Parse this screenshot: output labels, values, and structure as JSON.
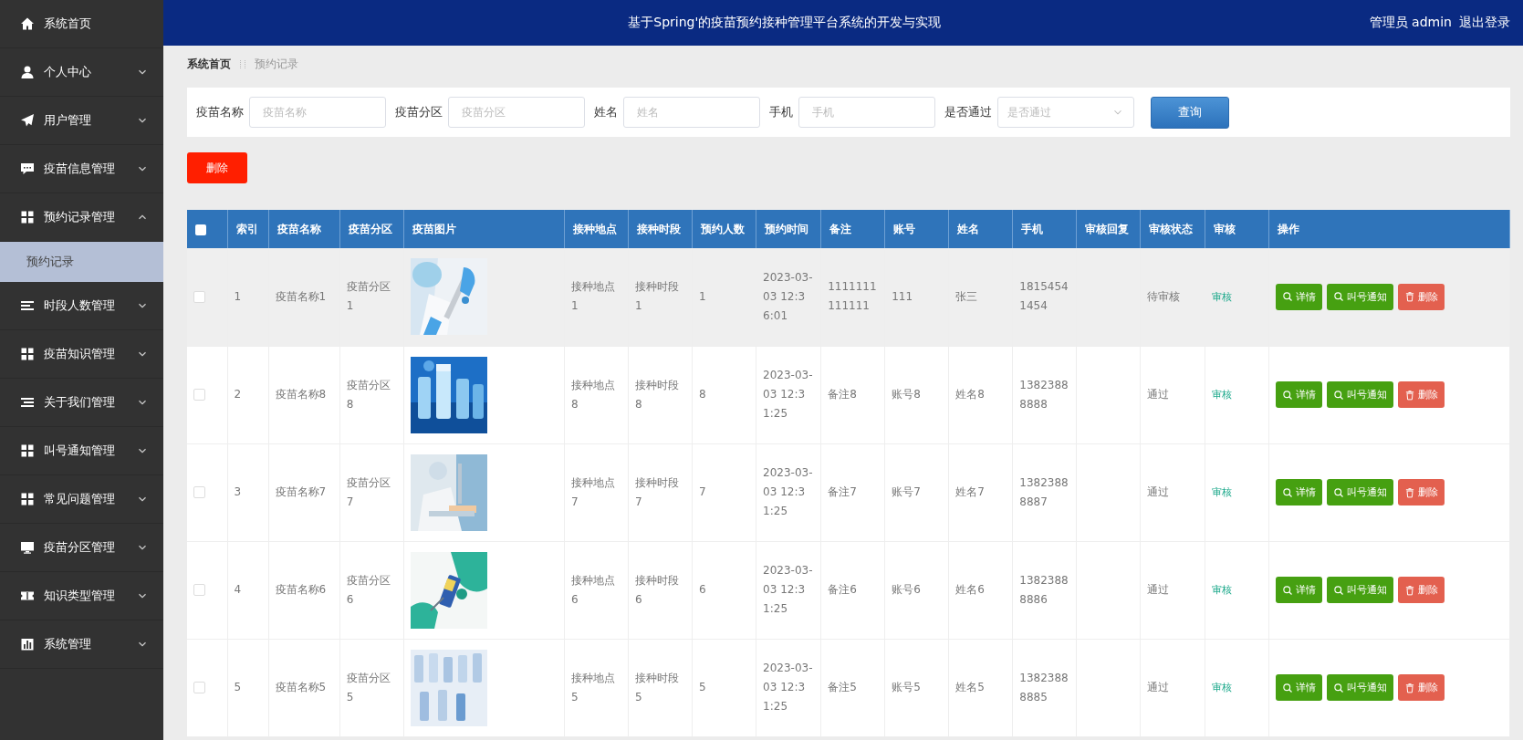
{
  "sidebar": {
    "items": [
      {
        "label": "系统首页"
      },
      {
        "label": "个人中心",
        "expanded": false
      },
      {
        "label": "用户管理",
        "expanded": false
      },
      {
        "label": "疫苗信息管理",
        "expanded": false
      },
      {
        "label": "预约记录管理",
        "expanded": true,
        "children": [
          {
            "label": "预约记录",
            "selected": true
          }
        ]
      },
      {
        "label": "时段人数管理",
        "expanded": false
      },
      {
        "label": "疫苗知识管理",
        "expanded": false
      },
      {
        "label": "关于我们管理",
        "expanded": false
      },
      {
        "label": "叫号通知管理",
        "expanded": false
      },
      {
        "label": "常见问题管理",
        "expanded": false
      },
      {
        "label": "疫苗分区管理",
        "expanded": false
      },
      {
        "label": "知识类型管理",
        "expanded": false
      },
      {
        "label": "系统管理",
        "expanded": false
      }
    ]
  },
  "header": {
    "title": "基于Spring'的疫苗预约接种管理平台系统的开发与实现",
    "user": "管理员 admin",
    "logout": "退出登录"
  },
  "breadcrumb": [
    "系统首页",
    "预约记录"
  ],
  "search": {
    "fields": [
      {
        "label": "疫苗名称",
        "placeholder": "疫苗名称",
        "kind": "text"
      },
      {
        "label": "疫苗分区",
        "placeholder": "疫苗分区",
        "kind": "text"
      },
      {
        "label": "姓名",
        "placeholder": "姓名",
        "kind": "text"
      },
      {
        "label": "手机",
        "placeholder": "手机",
        "kind": "text"
      },
      {
        "label": "是否通过",
        "placeholder": "是否通过",
        "kind": "select"
      }
    ],
    "button": "查询"
  },
  "delete_button": "删除",
  "table": {
    "select_all": {
      "checked": false
    },
    "columns": [
      "索引",
      "疫苗名称",
      "疫苗分区",
      "疫苗图片",
      "接种地点",
      "接种时段",
      "预约人数",
      "预约时间",
      "备注",
      "账号",
      "姓名",
      "手机",
      "审核回复",
      "审核状态",
      "审核",
      "操作"
    ],
    "rows": [
      {
        "checked": false,
        "hovered": true,
        "index": "1",
        "vaccine_name": "疫苗名称1",
        "vaccine_zone": "疫苗分区1",
        "location": "接种地点1",
        "time_slot": "接种时段1",
        "count": "1",
        "booking_time": "2023-03-03 12:36:01",
        "remark": "1111111111111",
        "account": "111",
        "name": "张三",
        "phone": "18154541454",
        "review_status": "待审核",
        "review": "审核",
        "actions": [
          {
            "label": "详情",
            "kind": "detail"
          },
          {
            "label": "叫号通知",
            "kind": "notify"
          },
          {
            "label": "删除",
            "kind": "delete"
          }
        ]
      },
      {
        "checked": false,
        "hovered": false,
        "index": "2",
        "vaccine_name": "疫苗名称8",
        "vaccine_zone": "疫苗分区8",
        "location": "接种地点8",
        "time_slot": "接种时段8",
        "count": "8",
        "booking_time": "2023-03-03 12:31:25",
        "remark": "备注8",
        "account": "账号8",
        "name": "姓名8",
        "phone": "13823888888",
        "review_status": "通过",
        "review": "审核",
        "actions": [
          {
            "label": "详情",
            "kind": "detail"
          },
          {
            "label": "叫号通知",
            "kind": "notify"
          },
          {
            "label": "删除",
            "kind": "delete"
          }
        ]
      },
      {
        "checked": false,
        "hovered": false,
        "index": "3",
        "vaccine_name": "疫苗名称7",
        "vaccine_zone": "疫苗分区7",
        "location": "接种地点7",
        "time_slot": "接种时段7",
        "count": "7",
        "booking_time": "2023-03-03 12:31:25",
        "remark": "备注7",
        "account": "账号7",
        "name": "姓名7",
        "phone": "13823888887",
        "review_status": "通过",
        "review": "审核",
        "actions": [
          {
            "label": "详情",
            "kind": "detail"
          },
          {
            "label": "叫号通知",
            "kind": "notify"
          },
          {
            "label": "删除",
            "kind": "delete"
          }
        ]
      },
      {
        "checked": false,
        "hovered": false,
        "index": "4",
        "vaccine_name": "疫苗名称6",
        "vaccine_zone": "疫苗分区6",
        "location": "接种地点6",
        "time_slot": "接种时段6",
        "count": "6",
        "booking_time": "2023-03-03 12:31:25",
        "remark": "备注6",
        "account": "账号6",
        "name": "姓名6",
        "phone": "13823888886",
        "review_status": "通过",
        "review": "审核",
        "actions": [
          {
            "label": "详情",
            "kind": "detail"
          },
          {
            "label": "叫号通知",
            "kind": "notify"
          },
          {
            "label": "删除",
            "kind": "delete"
          }
        ]
      },
      {
        "checked": false,
        "hovered": false,
        "index": "5",
        "vaccine_name": "疫苗名称5",
        "vaccine_zone": "疫苗分区5",
        "location": "接种地点5",
        "time_slot": "接种时段5",
        "count": "5",
        "booking_time": "2023-03-03 12:31:25",
        "remark": "备注5",
        "account": "账号5",
        "name": "姓名5",
        "phone": "13823888885",
        "review_status": "通过",
        "review": "审核",
        "actions": [
          {
            "label": "详情",
            "kind": "detail"
          },
          {
            "label": "叫号通知",
            "kind": "notify"
          },
          {
            "label": "删除",
            "kind": "delete"
          }
        ]
      }
    ]
  }
}
